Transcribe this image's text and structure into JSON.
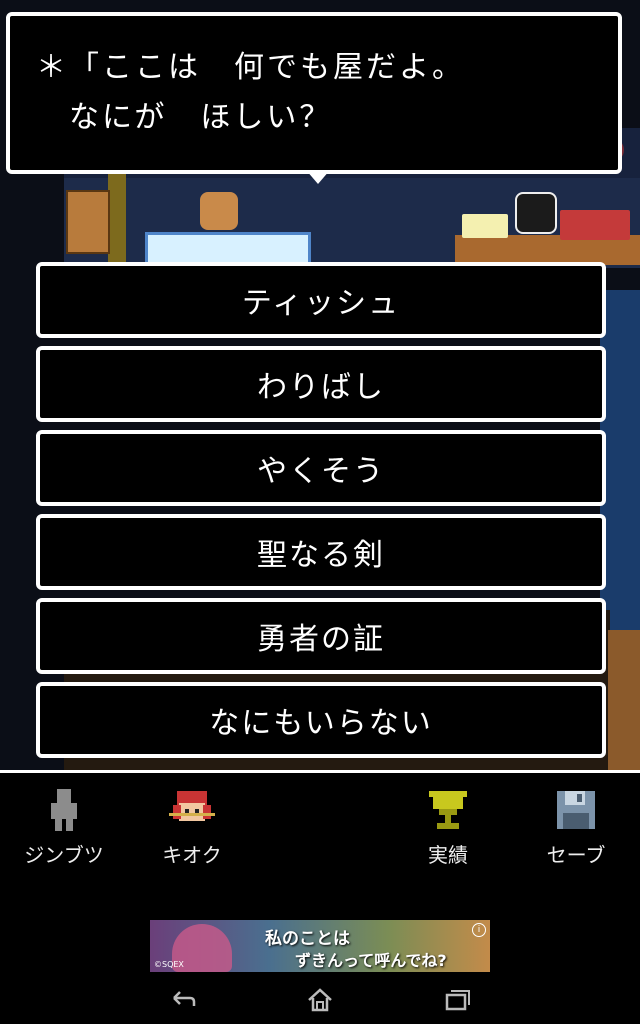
{
  "dialog": {
    "line1": "＊「ここは　何でも屋だよ。",
    "line2": "　なにが　ほしい？"
  },
  "options": [
    {
      "label": "ティッシュ"
    },
    {
      "label": "わりばし"
    },
    {
      "label": "やくそう"
    },
    {
      "label": "聖なる剣"
    },
    {
      "label": "勇者の証"
    },
    {
      "label": "なにもいらない"
    }
  ],
  "bottom_nav": [
    {
      "label": "ジンブツ",
      "icon": "person-icon"
    },
    {
      "label": "キオク",
      "icon": "memory-girl-icon"
    },
    {
      "label": "実績",
      "icon": "trophy-icon"
    },
    {
      "label": "セーブ",
      "icon": "save-disk-icon"
    }
  ],
  "ad": {
    "text1": "私のことは",
    "text2": "ずきんって呼んでね?",
    "copyright": "©SQEX",
    "info": "i"
  },
  "colors": {
    "dialog_border": "#ffffff",
    "background": "#000000"
  }
}
